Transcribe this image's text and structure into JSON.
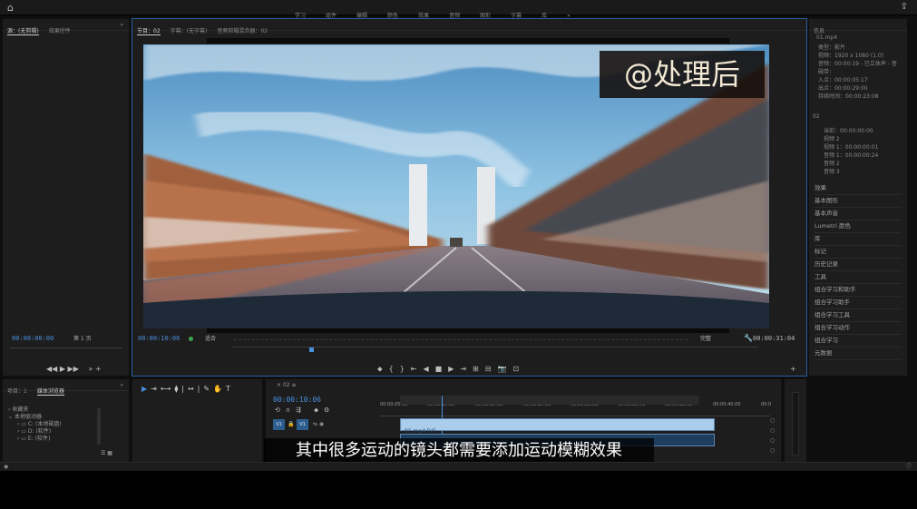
{
  "topbar": {
    "workspaces": [
      "学习",
      "组件",
      "编辑",
      "颜色",
      "效果",
      "音频",
      "图形",
      "字幕",
      "库",
      "»"
    ]
  },
  "source_panel": {
    "tabs": [
      "源：(无剪辑)",
      "效果控件",
      "»"
    ],
    "timecode": "00:00:00:00",
    "page": "第 1 页"
  },
  "program": {
    "tabs": [
      "节目：02",
      "字幕：(无字幕)",
      "音频剪辑混合器：02"
    ],
    "timecode": "00:00:10:06",
    "fit": "适合",
    "quality": "完整",
    "duration": "00:00:31:04",
    "watermark": "@处理后"
  },
  "properties": {
    "title": "信息",
    "clip_name": "01.mp4",
    "rows": [
      "类型：影片",
      "视频：1920 x 1080 (1.0)",
      "音频：00:00:19 - 已立体声 - 音",
      "磁带：",
      "入点：00:00:05:17",
      "出点：00:00:29:00",
      "持续时间：00:00:23:08"
    ],
    "seq_label": "02",
    "seq_rows": [
      "当前：00:00:00:00",
      "视频 2",
      "视频 1：00:00:00:01",
      "音频 1：00:00:00:24",
      "音频 2",
      "音频 3"
    ],
    "panels": [
      "效果",
      "基本图形",
      "基本声音",
      "Lumetri 颜色",
      "库",
      "标记",
      "历史记录",
      "工具",
      "组合学习和助手",
      "组合学习助手",
      "组合学习工具",
      "组合学习动作",
      "组合学习",
      "元数据"
    ]
  },
  "project_panel": {
    "tabs": [
      "项目：1",
      "媒体浏览器",
      "»"
    ],
    "items": [
      "收藏夹",
      "本地驱动器",
      "C: (本地磁盘)",
      "D: (软件)",
      "E: (软件)"
    ]
  },
  "timeline": {
    "tab": "02",
    "timecode": "00:00:10:06",
    "ruler": [
      "00:00:05:00",
      "00:00:10:00",
      "00:00:15:00",
      "00:00:20:00",
      "00:00:25:00",
      "00:00:30:00",
      "00:00:35:00",
      "00:00:40:00",
      "00:0"
    ],
    "tracks": [
      "V1",
      "V1"
    ],
    "clip_label": "01.mp4 [V]"
  },
  "subtitle": "其中很多运动的镜头都需要添加运动模糊效果"
}
